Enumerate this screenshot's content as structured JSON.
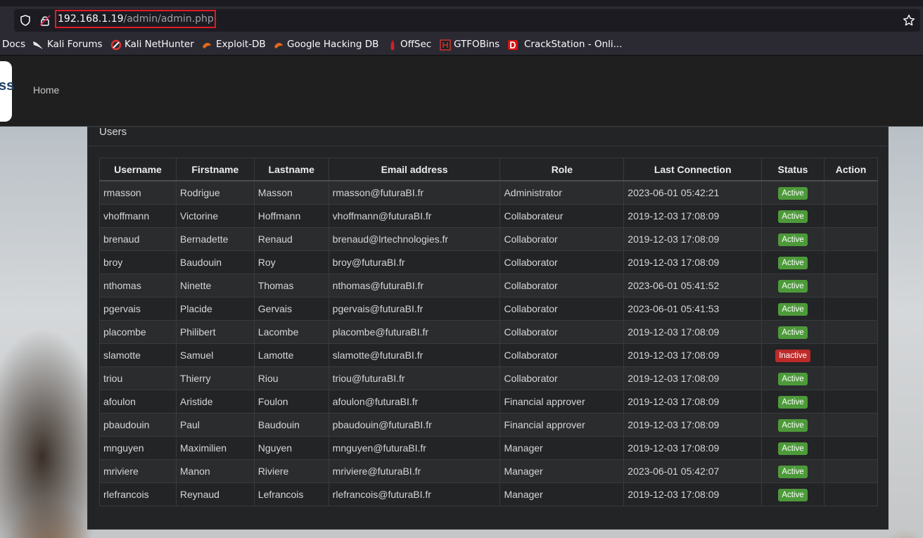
{
  "browser": {
    "url_host": "192.168.1.19",
    "url_path": "/admin/admin.php",
    "bookmarks": [
      "Docs",
      "Kali Forums",
      "Kali NetHunter",
      "Exploit-DB",
      "Google Hacking DB",
      "OffSec",
      "GTFOBins",
      "CrackStation - Onli..."
    ]
  },
  "nav": {
    "logo_fragment": "ss",
    "home": "Home"
  },
  "panel": {
    "title": "Users"
  },
  "table": {
    "headers": [
      "Username",
      "Firstname",
      "Lastname",
      "Email address",
      "Role",
      "Last Connection",
      "Status",
      "Action"
    ],
    "rows": [
      {
        "username": "rmasson",
        "firstname": "Rodrigue",
        "lastname": "Masson",
        "email": "rmasson@futuraBI.fr",
        "role": "Administrator",
        "last": "2023-06-01 05:42:21",
        "status": "Active"
      },
      {
        "username": "vhoffmann",
        "firstname": "Victorine",
        "lastname": "Hoffmann",
        "email": "vhoffmann@futuraBI.fr",
        "role": "Collaborateur",
        "last": "2019-12-03 17:08:09",
        "status": "Active"
      },
      {
        "username": "brenaud",
        "firstname": "Bernadette",
        "lastname": "Renaud",
        "email": "brenaud@lrtechnologies.fr",
        "role": "Collaborator",
        "last": "2019-12-03 17:08:09",
        "status": "Active"
      },
      {
        "username": "broy",
        "firstname": "Baudouin",
        "lastname": "Roy",
        "email": "broy@futuraBI.fr",
        "role": "Collaborator",
        "last": "2019-12-03 17:08:09",
        "status": "Active"
      },
      {
        "username": "nthomas",
        "firstname": "Ninette",
        "lastname": "Thomas",
        "email": "nthomas@futuraBI.fr",
        "role": "Collaborator",
        "last": "2023-06-01 05:41:52",
        "status": "Active"
      },
      {
        "username": "pgervais",
        "firstname": "Placide",
        "lastname": "Gervais",
        "email": "pgervais@futuraBI.fr",
        "role": "Collaborator",
        "last": "2023-06-01 05:41:53",
        "status": "Active"
      },
      {
        "username": "placombe",
        "firstname": "Philibert",
        "lastname": "Lacombe",
        "email": "placombe@futuraBI.fr",
        "role": "Collaborator",
        "last": "2019-12-03 17:08:09",
        "status": "Active"
      },
      {
        "username": "slamotte",
        "firstname": "Samuel",
        "lastname": "Lamotte",
        "email": "slamotte@futuraBI.fr",
        "role": "Collaborator",
        "last": "2019-12-03 17:08:09",
        "status": "Inactive"
      },
      {
        "username": "triou",
        "firstname": "Thierry",
        "lastname": "Riou",
        "email": "triou@futuraBI.fr",
        "role": "Collaborator",
        "last": "2019-12-03 17:08:09",
        "status": "Active"
      },
      {
        "username": "afoulon",
        "firstname": "Aristide",
        "lastname": "Foulon",
        "email": "afoulon@futuraBI.fr",
        "role": "Financial approver",
        "last": "2019-12-03 17:08:09",
        "status": "Active"
      },
      {
        "username": "pbaudouin",
        "firstname": "Paul",
        "lastname": "Baudouin",
        "email": "pbaudouin@futuraBI.fr",
        "role": "Financial approver",
        "last": "2019-12-03 17:08:09",
        "status": "Active"
      },
      {
        "username": "mnguyen",
        "firstname": "Maximilien",
        "lastname": "Nguyen",
        "email": "mnguyen@futuraBI.fr",
        "role": "Manager",
        "last": "2019-12-03 17:08:09",
        "status": "Active"
      },
      {
        "username": "mriviere",
        "firstname": "Manon",
        "lastname": "Riviere",
        "email": "mriviere@futuraBI.fr",
        "role": "Manager",
        "last": "2023-06-01 05:42:07",
        "status": "Active"
      },
      {
        "username": "rlefrancois",
        "firstname": "Reynaud",
        "lastname": "Lefrancois",
        "email": "rlefrancois@futuraBI.fr",
        "role": "Manager",
        "last": "2019-12-03 17:08:09",
        "status": "Active"
      }
    ]
  },
  "colors": {
    "active": "#4d9a3a",
    "inactive": "#bd2a2a",
    "url_highlight": "#e01b24"
  }
}
